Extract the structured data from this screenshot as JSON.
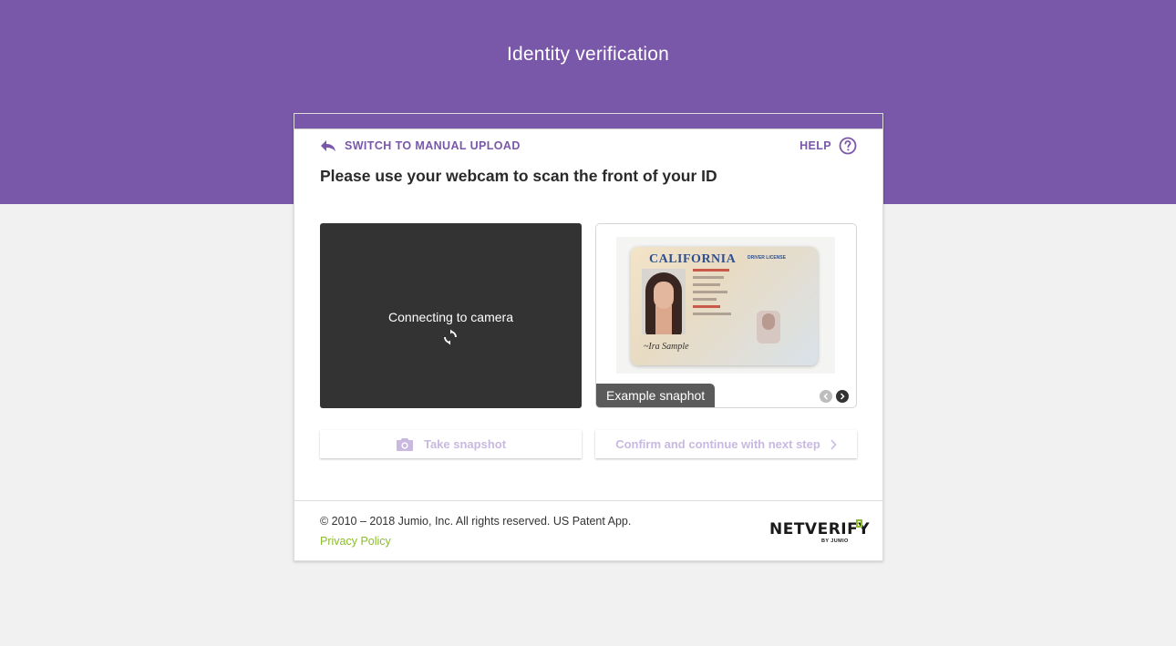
{
  "header": {
    "title": "Identity verification"
  },
  "card": {
    "switch_label": "SWITCH TO MANUAL UPLOAD",
    "help_label": "HELP",
    "instruction": "Please use your webcam to scan the front of your ID"
  },
  "camera": {
    "status_text": "Connecting to camera",
    "icon": "sync-icon"
  },
  "example": {
    "label": "Example snaphot",
    "id_card": {
      "state": "CALIFORNIA",
      "type": "DRIVER LICENSE"
    },
    "carousel_total": 2,
    "carousel_active": 2
  },
  "buttons": {
    "snapshot_label": "Take snapshot",
    "confirm_label": "Confirm and continue with next step"
  },
  "footer": {
    "copyright": "© 2010 – 2018 Jumio, Inc. All rights reserved. US Patent App.",
    "privacy_label": "Privacy Policy",
    "logo_text": "NETVERIFY",
    "logo_sub": "BY JUMIO"
  },
  "colors": {
    "brand": "#7957a9",
    "accent_green": "#8bbd2b",
    "camera_bg": "#333333",
    "disabled_text": "#c9b9e0"
  }
}
